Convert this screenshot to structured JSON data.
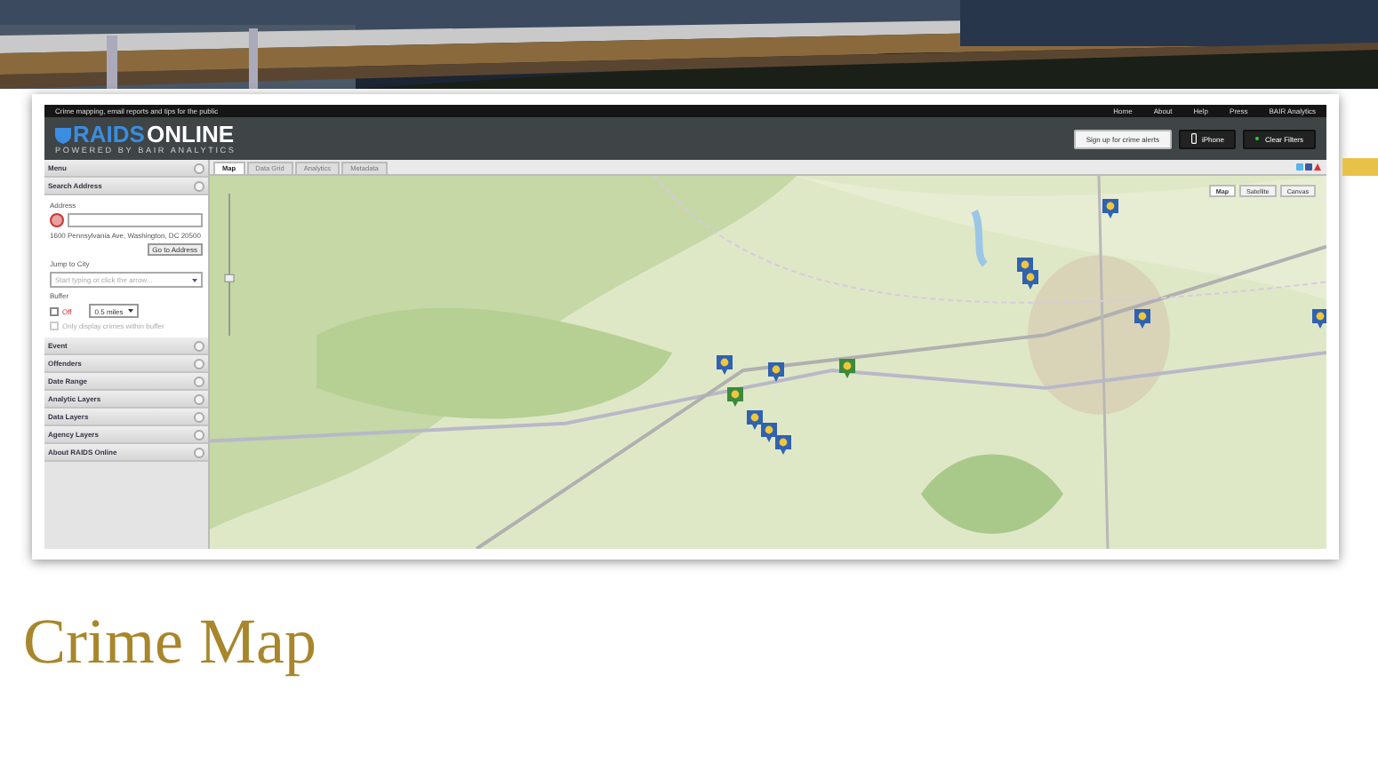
{
  "slide_title": "Crime Map",
  "site": {
    "tagline": "Crime mapping, email reports and tips for the public",
    "nav_links": [
      "Home",
      "About",
      "Help",
      "Press",
      "BAIR Analytics"
    ],
    "logo": {
      "brand_a": "RAIDS",
      "brand_b": "ONLINE",
      "subtitle": "POWERED BY BAIR ANALYTICS"
    },
    "header_buttons": [
      {
        "label": "Sign up for crime alerts",
        "kind": "light"
      },
      {
        "label": "iPhone",
        "kind": "phone"
      },
      {
        "label": "Clear Filters",
        "kind": "filter"
      }
    ]
  },
  "sidebar": {
    "menu_title": "Menu",
    "search_address": {
      "title": "Search Address",
      "address_label": "Address",
      "address_hint": "1600 Pennsylvania Ave, Washington, DC 20500",
      "go_button": "Go to Address",
      "jump_label": "Jump to City",
      "city_placeholder": "Start typing or click the arrow...",
      "buffer_label": "Buffer",
      "buffer_off": "Off",
      "buffer_off_checked": false,
      "buffer_distance": "0.5 miles",
      "only_buffer_label": "Only display crimes within buffer",
      "only_buffer_checked": false,
      "only_buffer_disabled": true
    },
    "panels": [
      "Event",
      "Offenders",
      "Date Range",
      "Analytic Layers",
      "Data Layers",
      "Agency Layers",
      "About RAIDS Online"
    ]
  },
  "tabs": [
    {
      "label": "Map",
      "selected": true
    },
    {
      "label": "Data Grid",
      "selected": false
    },
    {
      "label": "Analytics",
      "selected": false
    },
    {
      "label": "Metadata",
      "selected": false
    }
  ],
  "zoom": {
    "level": 0.4
  },
  "map_types": [
    {
      "label": "Map",
      "selected": true
    },
    {
      "label": "Satellite",
      "selected": false
    },
    {
      "label": "Canvas",
      "selected": false
    }
  ],
  "markers": [
    {
      "color": "#2f62b0"
    },
    {
      "color": "#2f62b0"
    },
    {
      "color": "#2f62b0"
    },
    {
      "color": "#2f62b0"
    },
    {
      "color": "#2f62b0"
    },
    {
      "color": "#2f62b0"
    },
    {
      "color": "#2f62b0"
    },
    {
      "color": "#3c8a3c"
    },
    {
      "color": "#3c8a3c"
    },
    {
      "color": "#2f62b0"
    },
    {
      "color": "#2f62b0"
    },
    {
      "color": "#2f62b0"
    }
  ]
}
